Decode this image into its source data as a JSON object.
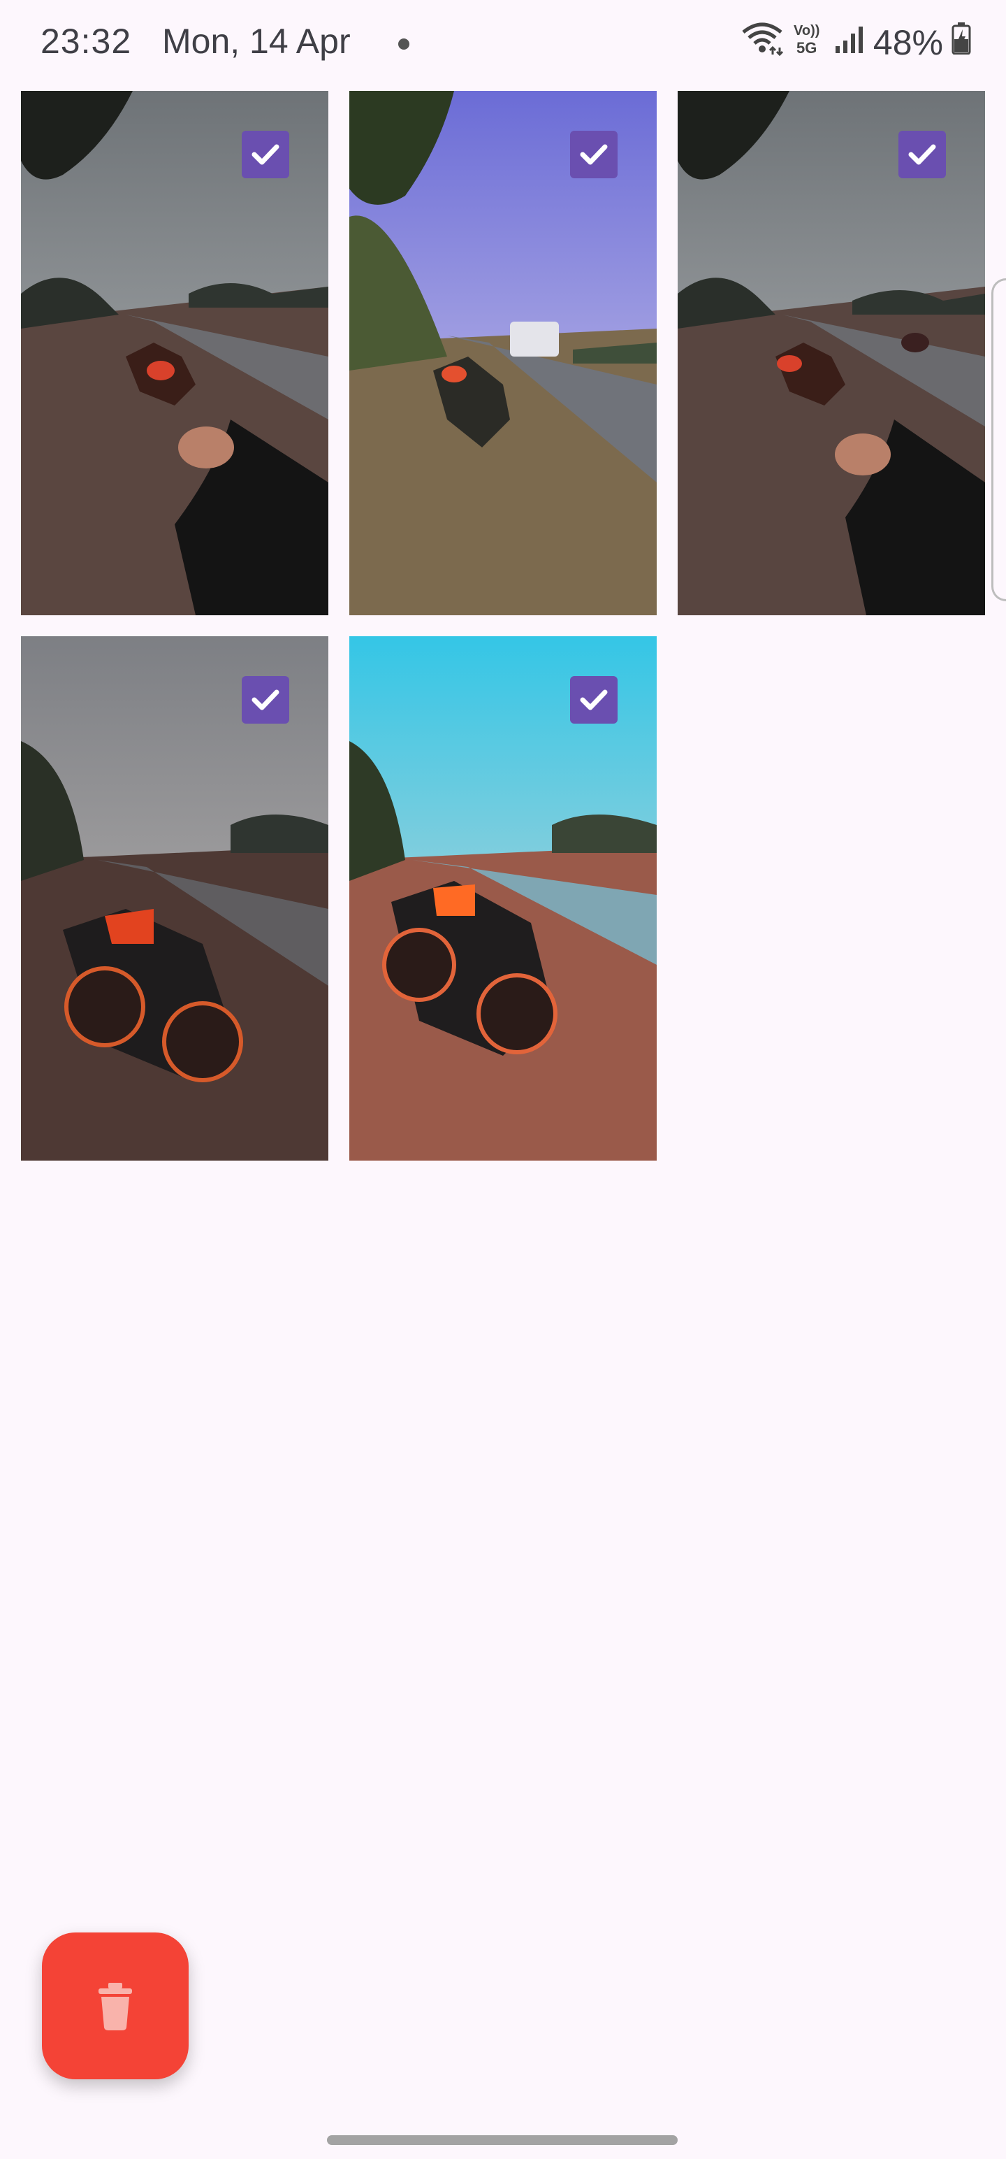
{
  "status_bar": {
    "time": "23:32",
    "date": "Mon, 14 Apr",
    "battery": "48%",
    "icons": [
      "wifi-icon",
      "volte-5g-icon",
      "signal-icon",
      "battery-charging-icon"
    ]
  },
  "gallery": {
    "photos": [
      {
        "name": "photo-1",
        "selected": true,
        "tone": "grey-sky"
      },
      {
        "name": "photo-2",
        "selected": true,
        "tone": "blue-sky"
      },
      {
        "name": "photo-3",
        "selected": true,
        "tone": "grey-sky"
      },
      {
        "name": "photo-4",
        "selected": true,
        "tone": "grey-sky"
      },
      {
        "name": "photo-5",
        "selected": true,
        "tone": "cyan-sky"
      }
    ],
    "selected_icon": "check-icon"
  },
  "fab": {
    "icon": "trash-icon",
    "color": "#f44336"
  },
  "colors": {
    "background": "#fdf7fd",
    "checkbox": "#6a4fb0"
  }
}
